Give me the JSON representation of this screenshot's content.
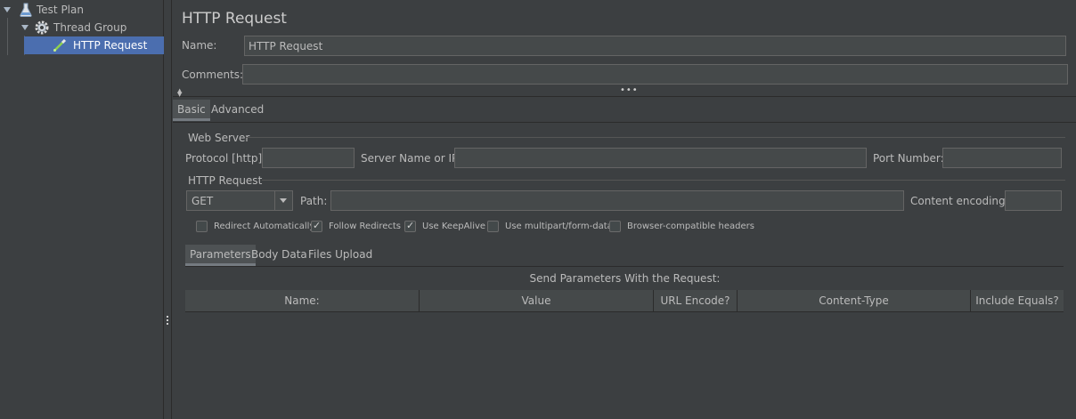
{
  "tree": {
    "items": [
      {
        "label": "Test Plan",
        "icon": "flask-icon"
      },
      {
        "label": "Thread Group",
        "icon": "gear-icon"
      },
      {
        "label": "HTTP Request",
        "icon": "pipette-icon",
        "selected": true
      }
    ]
  },
  "panel": {
    "title": "HTTP Request",
    "name_label": "Name:",
    "name_value": "HTTP Request",
    "comments_label": "Comments:",
    "comments_value": ""
  },
  "tabs": {
    "basic": "Basic",
    "advanced": "Advanced"
  },
  "web_server": {
    "section": "Web Server",
    "protocol_label": "Protocol [http]:",
    "server_label": "Server Name or IP:",
    "port_label": "Port Number:"
  },
  "http_request": {
    "section": "HTTP Request",
    "method": "GET",
    "path_label": "Path:",
    "encoding_label": "Content encoding:"
  },
  "options": [
    {
      "label": "Redirect Automatically",
      "checked": false
    },
    {
      "label": "Follow Redirects",
      "checked": true
    },
    {
      "label": "Use KeepAlive",
      "checked": true
    },
    {
      "label": "Use multipart/form-data",
      "checked": false
    },
    {
      "label": "Browser-compatible headers",
      "checked": false
    }
  ],
  "subtabs": {
    "parameters": "Parameters",
    "body": "Body Data",
    "files": "Files Upload"
  },
  "params": {
    "caption": "Send Parameters With the Request:",
    "columns": [
      "Name:",
      "Value",
      "URL Encode?",
      "Content-Type",
      "Include Equals?"
    ]
  },
  "colors": {
    "selection": "#4b6eaf",
    "background": "#3c3f41"
  }
}
